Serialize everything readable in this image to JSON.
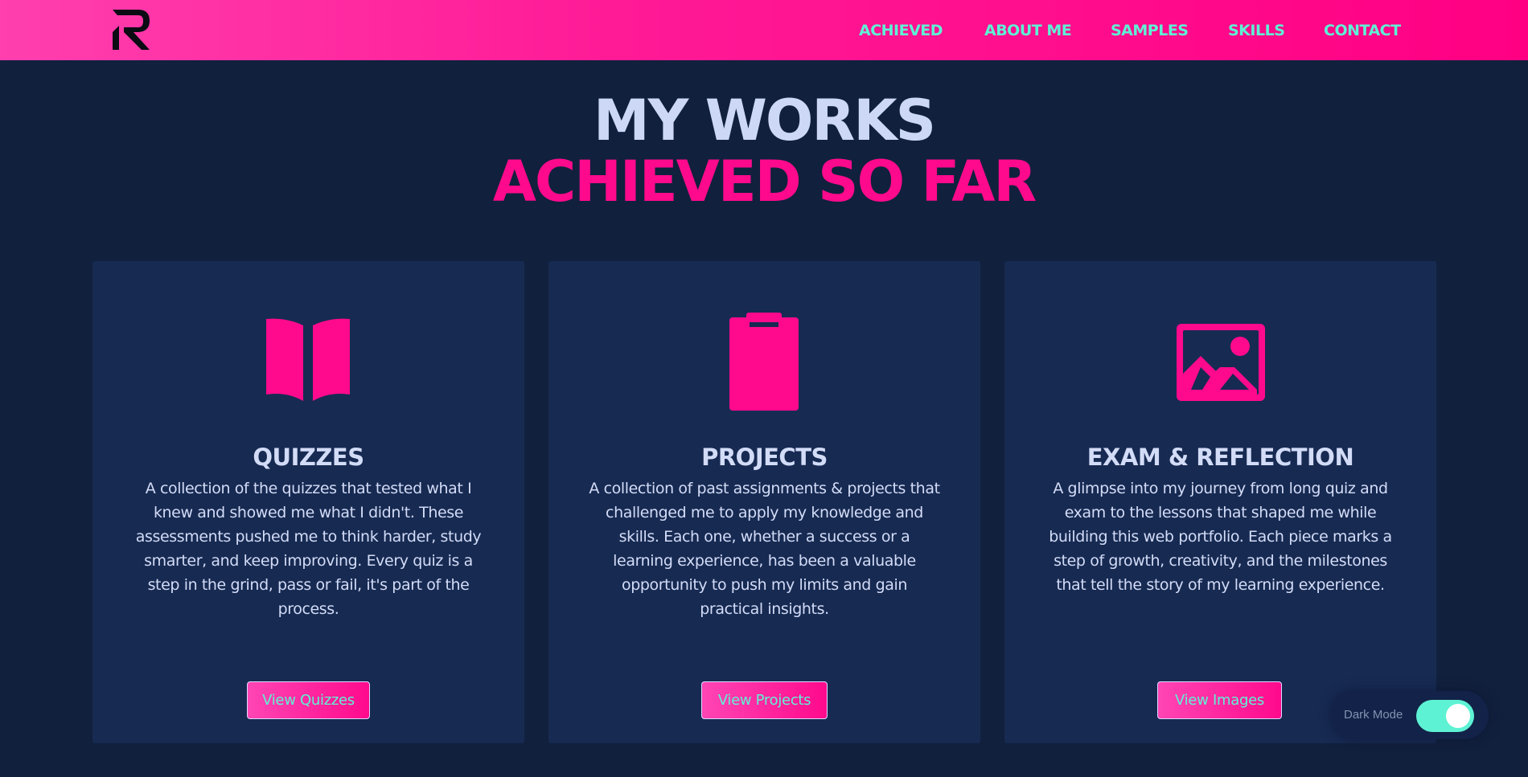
{
  "nav": {
    "logo_icon": "r-logo-icon",
    "links": [
      "ACHIEVED",
      "ABOUT ME",
      "SAMPLES",
      "SKILLS",
      "CONTACT"
    ]
  },
  "hero": {
    "line1": "MY WORKS",
    "line2": "ACHIEVED SO FAR"
  },
  "cards": [
    {
      "icon": "book-icon",
      "title": "QUIZZES",
      "description": "A collection of the quizzes that tested what I knew and showed me what I didn't. These assessments pushed me to think harder, study smarter, and keep improving. Every quiz is a step in the grind, pass or fail, it's part of the process.",
      "button": "View Quizzes"
    },
    {
      "icon": "clipboard-icon",
      "title": "PROJECTS",
      "description": "A collection of past assignments & projects that challenged me to apply my knowledge and skills. Each one, whether a success or a learning experience, has been a valuable opportunity to push my limits and gain practical insights.",
      "button": "View Projects"
    },
    {
      "icon": "image-icon",
      "title": "EXAM & REFLECTION",
      "description": "A glimpse into my journey from long quiz and exam to the lessons that shaped me while building this web portfolio. Each piece marks a step of growth, creativity, and the milestones that tell the story of my learning experience.",
      "button": "View Images"
    }
  ],
  "dark_mode": {
    "label": "Dark Mode",
    "enabled": true
  },
  "colors": {
    "accent_pink": "#ff0a8c",
    "accent_teal": "#5ef2d4",
    "background": "#11203d",
    "card": "#172a52",
    "text_light": "#cdd8f7"
  }
}
